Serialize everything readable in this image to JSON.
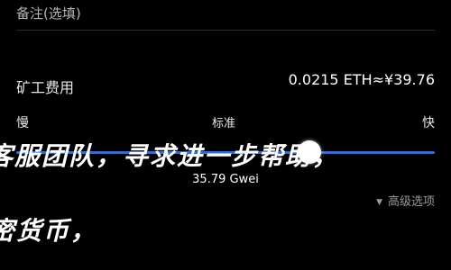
{
  "remark": {
    "label": "备注(选填)"
  },
  "fee": {
    "label": "矿工费用",
    "value": "0.0215 ETH≈¥39.76"
  },
  "speed": {
    "slow": "慢",
    "standard": "标准",
    "fast": "快",
    "level": 0.7
  },
  "gas": {
    "value": "35.79 Gwei"
  },
  "advanced": {
    "label": "高级选项",
    "icon": "caret-down-icon"
  },
  "overlay": {
    "line1": "客服团队，寻求进一步帮助，",
    "line2": "密货币，"
  },
  "colors": {
    "accent": "#2a6be6",
    "background": "#000000"
  }
}
